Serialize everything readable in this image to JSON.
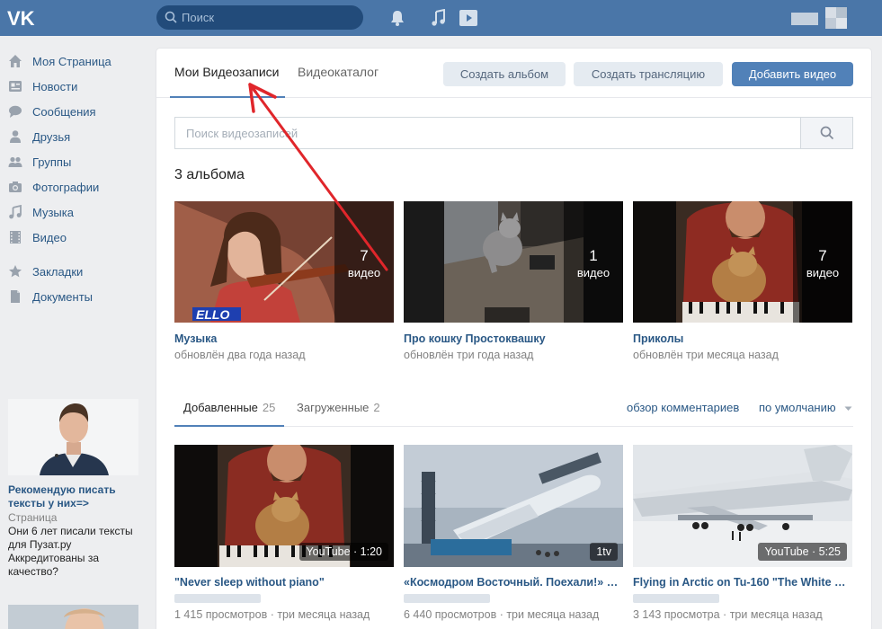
{
  "header": {
    "search_placeholder": "Поиск",
    "icons": [
      "vk-logo-icon",
      "search-icon",
      "bell-icon",
      "music-note-icon",
      "video-play-icon"
    ]
  },
  "nav": {
    "items": [
      {
        "label": "Моя Страница",
        "icon": "home-icon"
      },
      {
        "label": "Новости",
        "icon": "news-icon"
      },
      {
        "label": "Сообщения",
        "icon": "chat-icon"
      },
      {
        "label": "Друзья",
        "icon": "person-icon"
      },
      {
        "label": "Группы",
        "icon": "group-icon"
      },
      {
        "label": "Фотографии",
        "icon": "camera-icon"
      },
      {
        "label": "Музыка",
        "icon": "music-note-icon"
      },
      {
        "label": "Видео",
        "icon": "film-icon"
      },
      {
        "label": "Закладки",
        "icon": "star-icon"
      },
      {
        "label": "Документы",
        "icon": "document-icon"
      }
    ]
  },
  "ad": {
    "title": "Рекомендую писать тексты у них=>",
    "type": "Страница",
    "text": "Они 6 лет писали тексты для Пузат.ру Аккредитованы за качество?"
  },
  "tabs": {
    "my_videos": "Мои Видеозаписи",
    "catalog": "Видеокаталог"
  },
  "buttons": {
    "create_album": "Создать альбом",
    "create_stream": "Создать трансляцию",
    "add_video": "Добавить видео"
  },
  "video_search": {
    "placeholder": "Поиск видеозаписей"
  },
  "albums": {
    "heading": "3 альбома",
    "items": [
      {
        "title": "Музыка",
        "updated": "обновлён два года назад",
        "count": "7",
        "unit": "видео",
        "overlay": "ELLO"
      },
      {
        "title": "Про кошку Простоквашку",
        "updated": "обновлён три года назад",
        "count": "1",
        "unit": "видео"
      },
      {
        "title": "Приколы",
        "updated": "обновлён три месяца назад",
        "count": "7",
        "unit": "видео"
      }
    ]
  },
  "subtabs": {
    "added_label": "Добавленные",
    "added_count": "25",
    "uploaded_label": "Загруженные",
    "uploaded_count": "2",
    "comments_link": "обзор комментариев",
    "sort_label": "по умолчанию"
  },
  "videos": [
    {
      "title": "\"Never sleep without piano\"",
      "badge": "YouTube · 1:20",
      "views": "1 415 просмотров",
      "age": "три месяца назад"
    },
    {
      "title": "«Космодром Восточный. Поехали!» Д...",
      "badge": "1tv",
      "views": "6 440 просмотров",
      "age": "три месяца назад"
    },
    {
      "title": "Flying in Arctic on Tu-160 \"The White Sw...",
      "badge": "YouTube · 5:25",
      "views": "3 143 просмотра",
      "age": "три месяца назад"
    }
  ],
  "colors": {
    "header": "#4a76a8",
    "link": "#2a5885",
    "accent": "#5181b8",
    "annotation_arrow": "#e0262b"
  }
}
